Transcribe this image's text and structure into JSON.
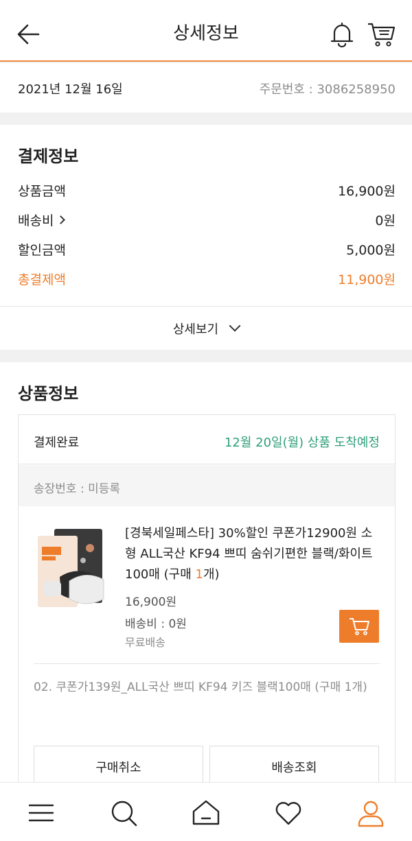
{
  "header": {
    "title": "상세정보",
    "icons": [
      "back-arrow-icon",
      "bell-icon",
      "cart-icon"
    ]
  },
  "order": {
    "date": "2021년 12월 16일",
    "order_number": "주문번호 : 3086258950"
  },
  "payment": {
    "title": "결제정보",
    "rows": [
      {
        "label": "상품금액",
        "value": "16,900원"
      },
      {
        "label": "배송비",
        "value": "0원"
      },
      {
        "label": "할인금액",
        "value": "5,000원"
      },
      {
        "label": "총결제액",
        "value": "11,900원"
      }
    ],
    "more_label": "상세보기"
  },
  "product": {
    "title": "상품정보",
    "status": "결제완료",
    "arrival": "12월 20일(월) 상품 도착예정",
    "tracking": "송장번호 : 미등록",
    "name_main": "[경북세일페스타] 30%할인 쿠폰가12900원 소형 ALL국산 KF94 쁘띠 숨쉬기편한 블랙/화이트 100매 (구매 ",
    "name_qty": "1",
    "name_suffix": "개)",
    "price": "16,900원",
    "shipping": "배송비 : 0원",
    "free_shipping": "무료배송",
    "option": "02. 쿠폰가139원_ALL국산 쁘띠 KF94 키즈 블랙100매 (구매 1개)",
    "cancel_label": "구매취소",
    "track_label": "배송조회"
  },
  "tabbar": {
    "icons": [
      "menu-icon",
      "search-icon",
      "home-icon",
      "heart-icon",
      "user-icon"
    ]
  },
  "colors": {
    "accent": "#ee7d2b",
    "arrival_green": "#2e9e7a",
    "muted": "#8c8c8c"
  }
}
